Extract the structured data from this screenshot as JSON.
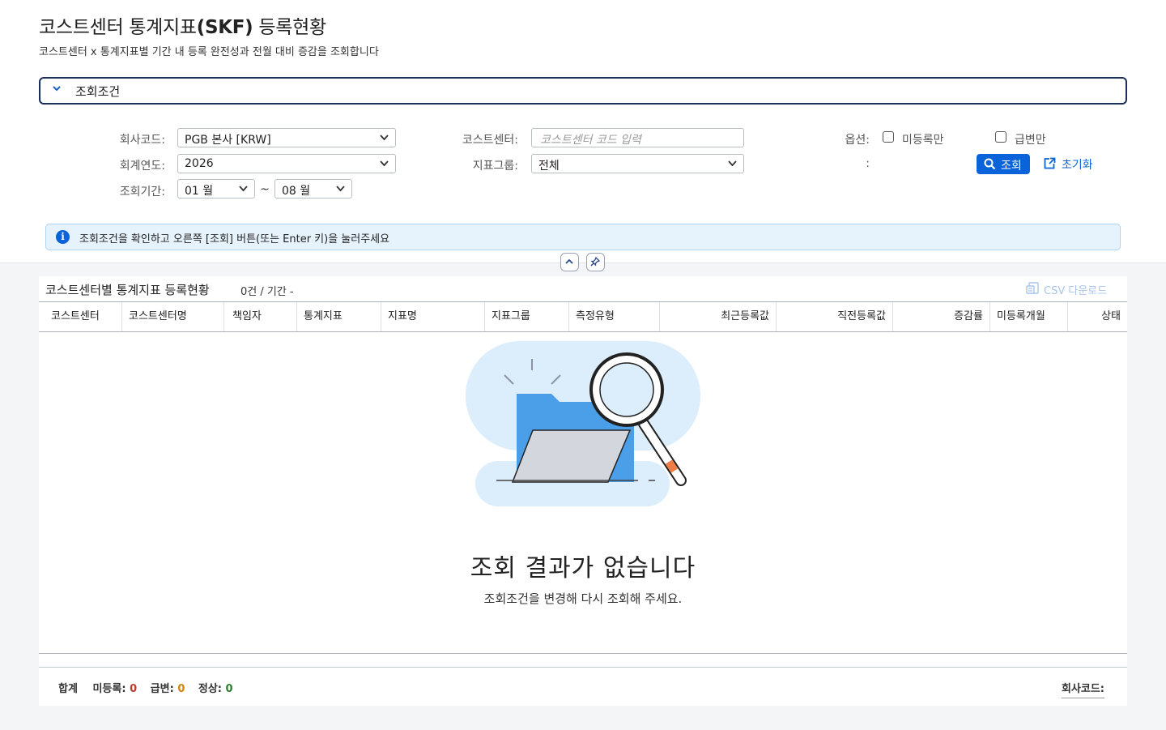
{
  "page": {
    "title_prefix": "코스트센터 통계지표",
    "title_bold": "(SKF)",
    "title_suffix": " 등록현황",
    "subtitle": "코스트센터 x 통계지표별 기간 내 등록 완전성과 전월 대비 증감을 조회합니다"
  },
  "conditions": {
    "header_label": "조회조건",
    "company_label": "회사코드:",
    "company_value": "PGB 본사 [KRW]",
    "year_label": "회계연도:",
    "year_value": "2026",
    "period_label": "조회기간:",
    "period_from": "01 월",
    "period_sep": "~",
    "period_to": "08 월",
    "cc_label": "코스트센터:",
    "cc_placeholder": "코스트센터 코드 입력",
    "group_label": "지표그룹:",
    "group_value": "전체",
    "option_label": "옵션:",
    "option_unregistered": "미등록만",
    "option_sudden": "급변만",
    "colon_only": ":",
    "search_button": "조회",
    "reset_button": "초기화"
  },
  "info": {
    "icon": "i",
    "text": "조회조건을 확인하고 오른쪽 [조회] 버튼(또는 Enter 키)을 눌러주세요"
  },
  "results": {
    "title": "코스트센터별 통계지표 등록현황",
    "count": "0건 / 기간 -",
    "csv_button": "CSV 다운로드",
    "columns": [
      "코스트센터",
      "코스트센터명",
      "책임자",
      "통계지표",
      "지표명",
      "지표그룹",
      "측정유형",
      "최근등록값",
      "직전등록값",
      "증감률",
      "미등록개월",
      "상태"
    ],
    "empty_title": "조회 결과가 없습니다",
    "empty_sub": "조회조건을 변경해 다시 조회해 주세요."
  },
  "footer": {
    "total_label": "합계",
    "unregistered_label": "미등록:",
    "unregistered_value": "0",
    "sudden_label": "급변:",
    "sudden_value": "0",
    "normal_label": "정상:",
    "normal_value": "0",
    "company_label": "회사코드:"
  },
  "colors": {
    "primary": "#0a63d8",
    "header_border": "#1b2f5e",
    "info_bg": "#e6f3fd",
    "unregistered": "#c0392b",
    "sudden": "#d4820a",
    "normal": "#2e7d32"
  },
  "icons": [
    "chevron-down-icon",
    "info-icon",
    "search-icon",
    "reset-icon",
    "collapse-up-icon",
    "pin-icon",
    "csv-icon",
    "empty-search-illustration"
  ]
}
